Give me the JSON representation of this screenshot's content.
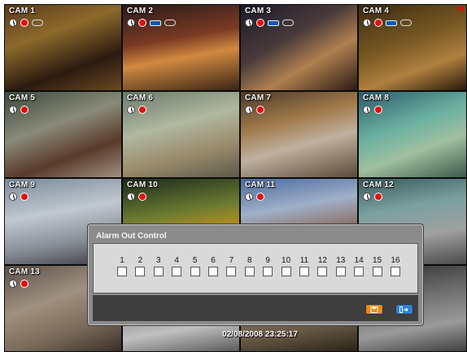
{
  "screen": {
    "timestamp": "02/08/2008 23:25:17"
  },
  "cameras": [
    {
      "label": "CAM 1",
      "icons": [
        "clock-icon",
        "record-icon",
        "audio-icon"
      ]
    },
    {
      "label": "CAM 2",
      "icons": [
        "clock-icon",
        "record-icon",
        "motion-icon",
        "audio-icon"
      ]
    },
    {
      "label": "CAM 3",
      "icons": [
        "clock-icon",
        "record-icon",
        "motion-icon",
        "audio-icon"
      ]
    },
    {
      "label": "CAM 4",
      "icons": [
        "clock-icon",
        "record-icon",
        "motion-icon",
        "audio-icon"
      ]
    },
    {
      "label": "CAM 5",
      "icons": [
        "clock-icon",
        "record-icon"
      ]
    },
    {
      "label": "CAM 6",
      "icons": [
        "clock-icon",
        "record-icon"
      ]
    },
    {
      "label": "CAM 7",
      "icons": [
        "clock-icon",
        "record-icon"
      ]
    },
    {
      "label": "CAM 8",
      "icons": [
        "clock-icon",
        "record-icon"
      ]
    },
    {
      "label": "CAM 9",
      "icons": [
        "clock-icon",
        "record-icon"
      ]
    },
    {
      "label": "CAM 10",
      "icons": [
        "clock-icon",
        "record-icon"
      ]
    },
    {
      "label": "CAM 11",
      "icons": [
        "clock-icon",
        "record-icon"
      ]
    },
    {
      "label": "CAM 12",
      "icons": [
        "clock-icon",
        "record-icon"
      ]
    },
    {
      "label": "CAM 13",
      "icons": [
        "clock-icon",
        "record-icon"
      ]
    },
    {
      "label": "",
      "icons": []
    },
    {
      "label": "",
      "icons": []
    },
    {
      "label": "",
      "icons": []
    }
  ],
  "dialog": {
    "title": "Alarm Out Control",
    "alarms": [
      "1",
      "2",
      "3",
      "4",
      "5",
      "6",
      "7",
      "8",
      "9",
      "10",
      "11",
      "12",
      "13",
      "14",
      "15",
      "16"
    ],
    "save_icon": "save-icon",
    "exit_icon": "exit-icon"
  },
  "colors": {
    "record": "#e01010",
    "save_button": "#e88a1a",
    "exit_button": "#2e7fd6",
    "dialog_bg": "#8b8b8b"
  }
}
